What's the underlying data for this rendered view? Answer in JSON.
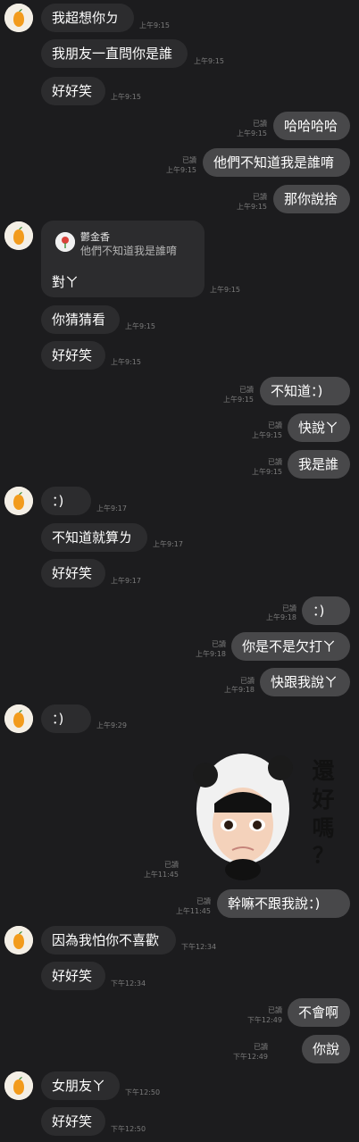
{
  "messages": [
    {
      "text": "我超想你ㄉ",
      "time": "上午9:15"
    },
    {
      "text": "我朋友一直問你是誰",
      "time": "上午9:15"
    },
    {
      "text": "好好笑",
      "time": "上午9:15"
    },
    {
      "text": "哈哈哈哈",
      "read": "已讀",
      "time": "上午9:15"
    },
    {
      "text": "他們不知道我是誰唷",
      "read": "已讀",
      "time": "上午9:15"
    },
    {
      "text": "那你說捨",
      "read": "已讀",
      "time": "上午9:15"
    },
    {
      "reply_name": "鬱金香",
      "reply_quote": "他們不知道我是誰唷",
      "text": "對ㄚ",
      "time": "上午9:15"
    },
    {
      "text": "你猜猜看",
      "time": "上午9:15"
    },
    {
      "text": "好好笑",
      "time": "上午9:15"
    },
    {
      "text": "不知道：)",
      "read": "已讀",
      "time": "上午9:15"
    },
    {
      "text": "快說ㄚ",
      "read": "已讀",
      "time": "上午9:15"
    },
    {
      "text": "我是誰",
      "read": "已讀",
      "time": "上午9:15"
    },
    {
      "text": "：)",
      "time": "上午9:17"
    },
    {
      "text": "不知道就算ㄌ",
      "time": "上午9:17"
    },
    {
      "text": "好好笑",
      "time": "上午9:17"
    },
    {
      "text": "：)",
      "read": "已讀",
      "time": "上午9:18"
    },
    {
      "text": "你是不是欠打ㄚ",
      "read": "已讀",
      "time": "上午9:18"
    },
    {
      "text": "快跟我說ㄚ",
      "read": "已讀",
      "time": "上午9:18"
    },
    {
      "text": "：)",
      "time": "上午9:29"
    },
    {
      "sticker_text": "還好嗎？",
      "read": "已讀",
      "time": "上午11:45"
    },
    {
      "text": "幹嘛不跟我說：)",
      "read": "已讀",
      "time": "上午11:45"
    },
    {
      "text": "因為我怕你不喜歡",
      "time": "下午12:34"
    },
    {
      "text": "好好笑",
      "time": "下午12:34"
    },
    {
      "text": "不會啊",
      "read": "已讀",
      "time": "下午12:49"
    },
    {
      "text": "你說",
      "read": "已讀",
      "time": "下午12:49"
    },
    {
      "text": "女朋友ㄚ",
      "time": "下午12:50"
    },
    {
      "text": "好好笑",
      "time": "下午12:50"
    }
  ],
  "colors": {
    "background": "#1c1c1e",
    "incoming": "#2c2c2e",
    "outgoing": "#48484a",
    "meta": "#7b7b7b"
  },
  "icons": {
    "avatar": "orange-avatar-icon",
    "reply_avatar": "flower-avatar-icon"
  }
}
